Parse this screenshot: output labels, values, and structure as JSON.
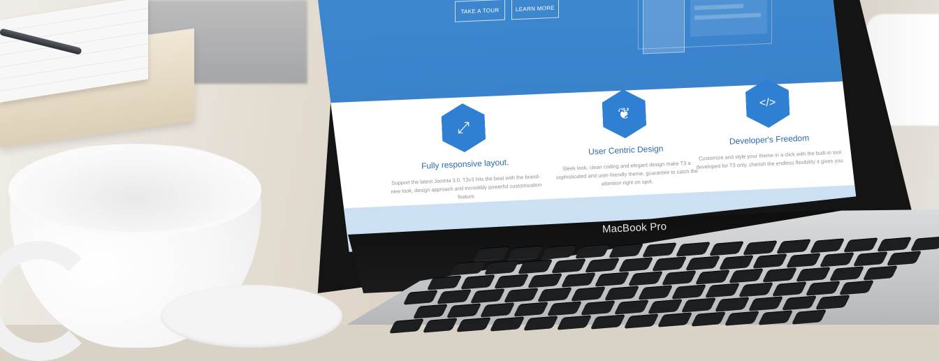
{
  "scene": {
    "description_colors": {
      "screen_blue": "#3d87cf",
      "hex_blue": "#2f7fd3",
      "band": "#cbe0f2"
    }
  },
  "hero": {
    "buttons": [
      {
        "label": "TAKE A TOUR"
      },
      {
        "label": "LEARN MORE"
      }
    ]
  },
  "features": [
    {
      "icon": "expand-arrows-icon",
      "title": "Fully responsive layout.",
      "desc": "Support the latest Joomla 3.0, T3v3 hits the beat with the brand-new look, design approach and incredibly powerful customization feature."
    },
    {
      "icon": "leaf-icon",
      "title": "User Centric Design",
      "desc": "Sleek look, clean coding and elegant design make T3 a sophisticated and user-friendly theme, guarantee to catch the attention right on spot."
    },
    {
      "icon": "code-icon",
      "title": "Developer's Freedom",
      "desc": "Customize and style your theme in a click with the built-in tool developed for T3 only, cherish the endless flexibility it gives you."
    }
  ],
  "laptop": {
    "brand": "MacBook Pro"
  }
}
